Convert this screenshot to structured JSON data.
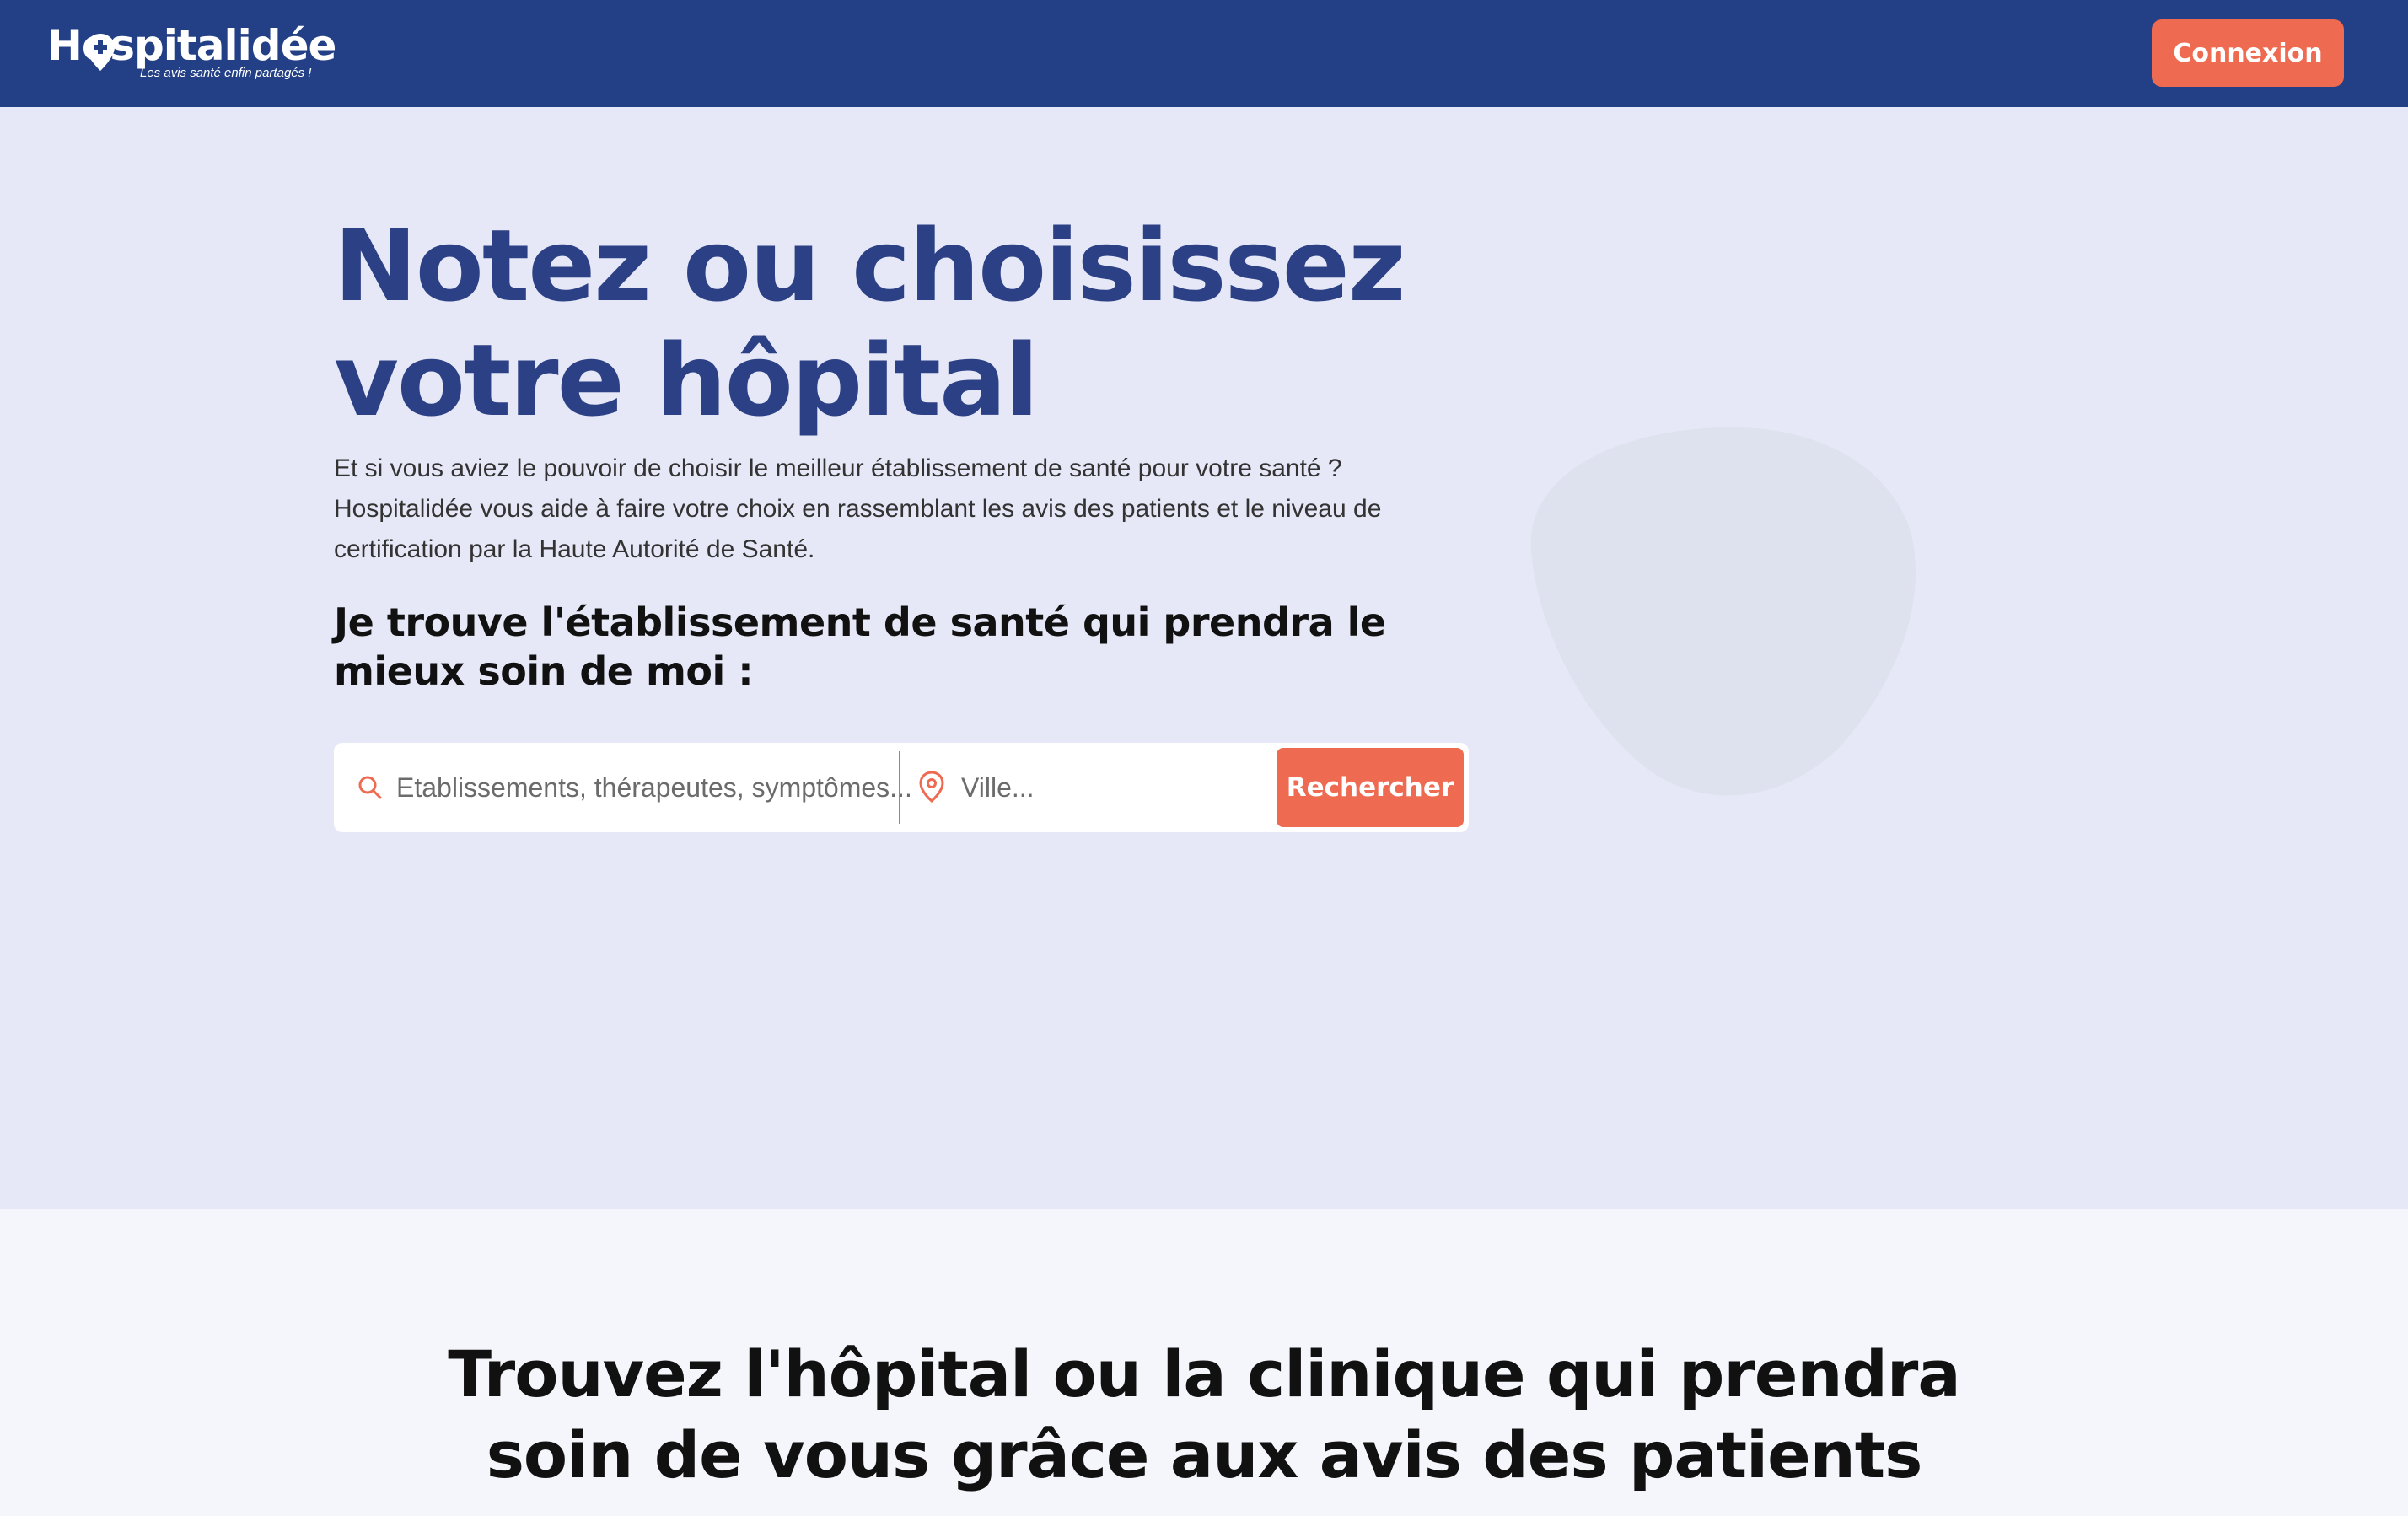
{
  "header": {
    "logo_text": "Hospitalidée",
    "logo_tagline": "Les avis santé enfin partagés !",
    "login_label": "Connexion"
  },
  "hero": {
    "title_line1": "Notez ou choisissez",
    "title_line2": "votre hôpital",
    "description": "Et si vous aviez le pouvoir de choisir le meilleur établissement de santé pour votre santé ? Hospitalidée vous aide à faire votre choix en rassemblant les avis des patients et le niveau de certification par la Haute Autorité de Santé.",
    "search_heading": "Je trouve l'établissement de santé qui prendra le mieux soin de moi :"
  },
  "search": {
    "query_placeholder": "Etablissements, thérapeutes, symptômes...",
    "city_placeholder": "Ville...",
    "button_label": "Rechercher"
  },
  "section2": {
    "title_line1": "Trouvez l'hôpital ou la clinique qui prendra",
    "title_line2": "soin de vous grâce aux avis des patients"
  },
  "colors": {
    "header_bg": "#233f85",
    "accent": "#ee6b52",
    "hero_bg": "#e6e8f7",
    "hero_title": "#2c4085"
  },
  "icons": {
    "search": "search-icon",
    "location": "location-pin-icon",
    "logo_pin": "logo-pin-icon"
  }
}
